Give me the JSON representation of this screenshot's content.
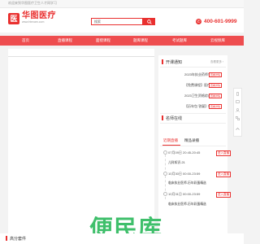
{
  "topbar": {
    "welcome": "欢迎来到华图医疗卫生人才网学习"
  },
  "logo": {
    "mark": "医",
    "name": "华图医疗",
    "url": "www.htexam.com"
  },
  "search": {
    "value": "搜索"
  },
  "phone": {
    "number": "400-601-9999"
  },
  "nav": {
    "items": [
      {
        "label": "首页"
      },
      {
        "label": "直播课程"
      },
      {
        "label": "面授课程"
      },
      {
        "label": "题库课程"
      },
      {
        "label": "考试题库"
      },
      {
        "label": "云视频库"
      }
    ]
  },
  "sidebar": {
    "notice_title": "开课通知",
    "notice_more": "查看更多 ›",
    "notices": [
      {
        "text": "2023年执业药师考试...",
        "tag": "查看详情"
      },
      {
        "text": "【免费课程】医疗卫...",
        "tag": "查看详情"
      },
      {
        "text": "2023卫生资格综合笔...",
        "tag": "查看详情"
      },
      {
        "text": "【历年包 答疑】新...",
        "tag": "查看详情"
      }
    ],
    "teachers_title": "名师在线",
    "tabs": [
      {
        "label": "近期直播"
      },
      {
        "label": "精品录播"
      }
    ],
    "live": [
      {
        "date": "07月09日 20:45-20:45",
        "title": "儿科知识-21",
        "button": "进入直播"
      },
      {
        "date": "10月30日 00:00-23:59",
        "title": "临床执业医师-历年彩蛋精选",
        "button": "进入直播"
      },
      {
        "date": "10月31日 00:00-23:59",
        "title": "临床执业医师-历年彩蛋精选",
        "button": "进入直播"
      }
    ]
  },
  "bottom": {
    "title": "高分套件"
  },
  "watermark": {
    "text": "便民库"
  },
  "colors": {
    "brand": "#e9302f",
    "nav": "#ee4d4f",
    "watermark": "#3fbf6b"
  }
}
